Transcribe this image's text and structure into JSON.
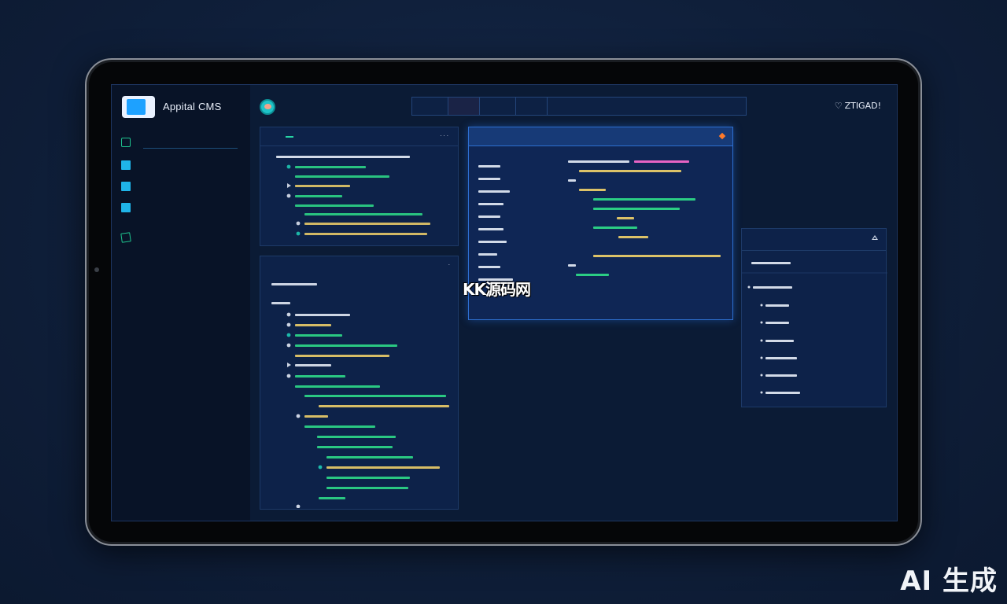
{
  "app": {
    "title": "Appital CMS"
  },
  "sidebar": {
    "items": [
      {
        "icon": "outline-square-icon",
        "label": ""
      },
      {
        "icon": "folder-icon",
        "label": ""
      },
      {
        "icon": "folder-icon",
        "label": ""
      },
      {
        "icon": "folder-icon",
        "label": ""
      },
      {
        "icon": "document-icon",
        "label": ""
      },
      {
        "icon": "none",
        "label": ""
      },
      {
        "icon": "none",
        "label": ""
      },
      {
        "icon": "none",
        "label": ""
      },
      {
        "icon": "none",
        "label": ""
      }
    ]
  },
  "header": {
    "brand": "",
    "tabs": [
      "",
      "",
      "",
      ""
    ],
    "links": [
      "",
      ""
    ],
    "user": "ZTIGAD!"
  },
  "colors": {
    "accent": "#1da1ff",
    "highlight_text": "#27d3a4",
    "active_tab": "#ff5570",
    "focus_border": "#2d6fd0"
  },
  "watermark": "KK源码网",
  "badge": "AI 生成"
}
